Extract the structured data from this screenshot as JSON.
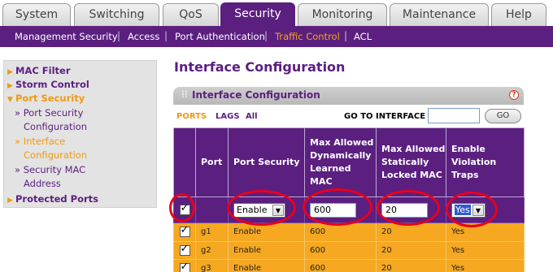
{
  "tabs": [
    "System",
    "Switching",
    "QoS",
    "Security",
    "Monitoring",
    "Maintenance",
    "Help"
  ],
  "active_tab": "Security",
  "subnav": [
    "Management Security",
    "Access",
    "Port Authentication",
    "Traffic Control",
    "ACL"
  ],
  "active_subnav": "Traffic Control",
  "sidebar": {
    "mac_filter": "MAC Filter",
    "storm_control": "Storm Control",
    "port_security": "Port Security",
    "port_security_config_1": "» Port Security",
    "port_security_config_2": "Configuration",
    "interface_config_1": "» Interface",
    "interface_config_2": "Configuration",
    "security_mac_1": "» Security MAC",
    "security_mac_2": "Address",
    "protected_ports": "Protected Ports"
  },
  "page_title": "Interface Configuration",
  "panel_title": "Interface Configuration",
  "help_glyph": "?",
  "filter": {
    "ports": "PORTS",
    "lags": "LAGS",
    "all": "All",
    "goto_label": "GO TO INTERFACE",
    "goto_value": "",
    "go_button": "GO"
  },
  "table": {
    "headers": {
      "port": "Port",
      "port_security": "Port Security",
      "max_dynamic": "Max Allowed Dynamically Learned MAC",
      "max_static": "Max Allowed Statically Locked MAC",
      "violation_traps": "Enable Violation Traps"
    },
    "edit": {
      "port_security": "Enable",
      "max_dynamic": "600",
      "max_static": "20",
      "violation_traps": "Yes"
    },
    "rows": [
      {
        "port": "g1",
        "port_security": "Enable",
        "max_dynamic": "600",
        "max_static": "20",
        "violation_traps": "Yes"
      },
      {
        "port": "g2",
        "port_security": "Enable",
        "max_dynamic": "600",
        "max_static": "20",
        "violation_traps": "Yes"
      },
      {
        "port": "g3",
        "port_security": "Enable",
        "max_dynamic": "600",
        "max_static": "20",
        "violation_traps": "Yes"
      }
    ]
  },
  "colors": {
    "brand_purple": "#5b1f80",
    "accent_orange": "#f5a820",
    "annotation_red": "#e8001c"
  }
}
